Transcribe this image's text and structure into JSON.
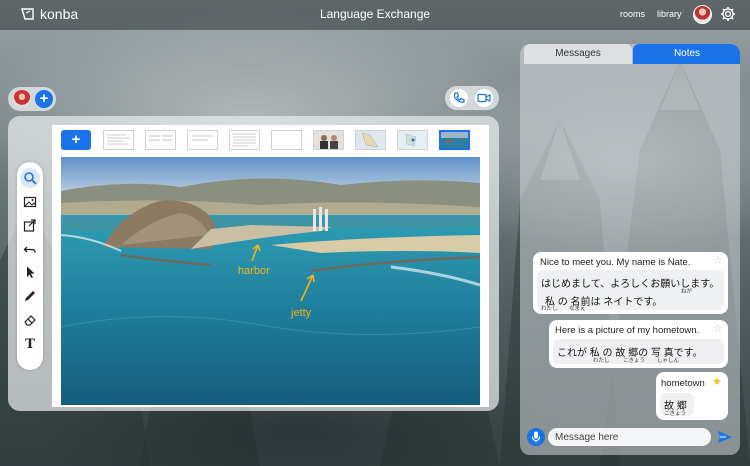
{
  "app": {
    "logo_text": "konba",
    "title": "Language Exchange",
    "nav": {
      "rooms": "rooms",
      "library": "library"
    }
  },
  "board": {
    "add_slide_label": "+",
    "add_person_label": "+",
    "tools": [
      "search-icon",
      "image-icon",
      "share-icon",
      "undo-icon",
      "pointer-icon",
      "pen-icon",
      "eraser-icon",
      "text-icon"
    ],
    "text_tool_label": "T",
    "slides_count": 9,
    "annotations": {
      "harbor": "harbor",
      "jetty": "jetty"
    }
  },
  "chat": {
    "tabs": {
      "messages": "Messages",
      "notes": "Notes"
    },
    "messages": [
      {
        "text": "Nice to meet you. My name is Nate.",
        "translation_line1": "はじめまして、よろしくお願いします。",
        "ruby_line1": "ねが",
        "translation_line2": "私 の 名前は ネイトです。",
        "ruby_line2a": "わたし",
        "ruby_line2b": "なまえ",
        "starred": false
      },
      {
        "text": "Here is a picture of my hometown.",
        "translation": "これが 私 の 故 郷の 写 真です。",
        "ruby_a": "わたし",
        "ruby_b": "こきょう",
        "ruby_c": "しゃしん",
        "starred": false
      },
      {
        "text": "hometown",
        "translation": "故 郷",
        "ruby": "こきょう",
        "starred": true
      }
    ],
    "input": {
      "placeholder": "Message here"
    },
    "colors": {
      "accent": "#1a73e8",
      "star_active": "#f2c21a",
      "star_inactive": "#c8c8c8"
    }
  }
}
